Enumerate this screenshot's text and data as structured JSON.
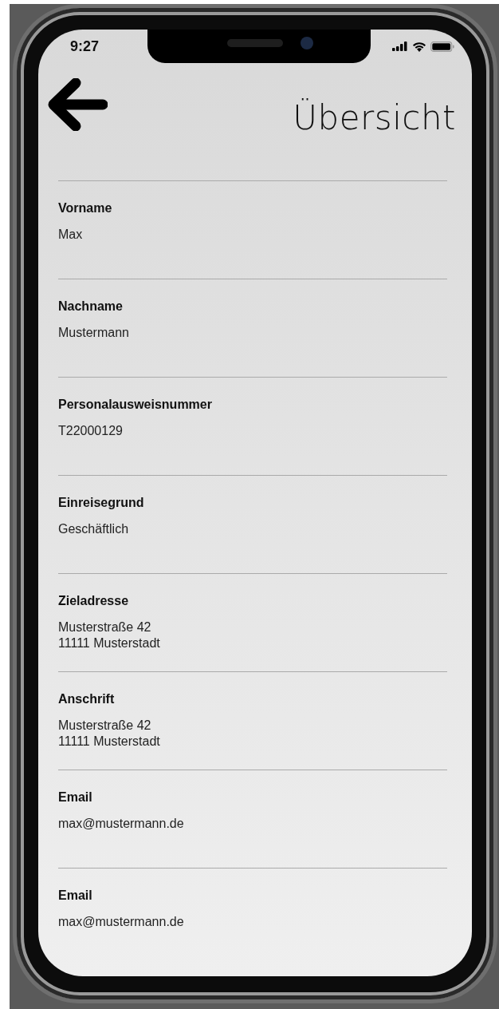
{
  "status_bar": {
    "time": "9:27"
  },
  "header": {
    "title": "Übersicht"
  },
  "fields": [
    {
      "label": "Vorname",
      "value": [
        "Max"
      ]
    },
    {
      "label": "Nachname",
      "value": [
        "Mustermann"
      ]
    },
    {
      "label": "Personalausweisnummer",
      "value": [
        "T22000129"
      ]
    },
    {
      "label": "Einreisegrund",
      "value": [
        "Geschäftlich"
      ]
    },
    {
      "label": "Zieladresse",
      "value": [
        "Musterstraße 42",
        "11111 Musterstadt"
      ]
    },
    {
      "label": "Anschrift",
      "value": [
        "Musterstraße 42",
        "11111 Musterstadt"
      ]
    },
    {
      "label": "Email",
      "value": [
        "max@mustermann.de"
      ]
    },
    {
      "label": "Email",
      "value": [
        "max@mustermann.de"
      ]
    }
  ]
}
